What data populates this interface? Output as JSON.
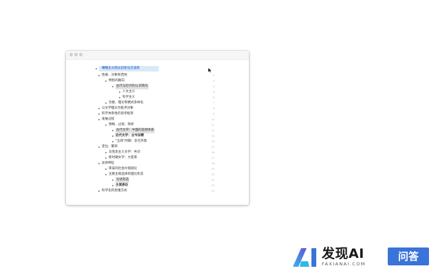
{
  "outline": {
    "root": "唯物主义的认识论与方法论",
    "items": [
      {
        "label": "性质、对象和范围",
        "num": "2"
      },
      {
        "label": "特别的路向",
        "num": "3"
      },
      {
        "label": "古代与近代的认识转向",
        "num": "4"
      },
      {
        "label": "人文主义",
        "num": "5"
      },
      {
        "label": "科学主义",
        "num": "6"
      },
      {
        "label": "功能、理论和模式多样化",
        "num": "7"
      },
      {
        "label": "以文学理论为批评对象",
        "num": "8"
      },
      {
        "label": "科学体系性的思考框架",
        "num": "9"
      },
      {
        "label": "发展过程",
        "num": "10"
      },
      {
        "label": "预制、过渡、转折",
        "num": "11"
      },
      {
        "label": "古代文学：中国的思想体系",
        "num": "12"
      },
      {
        "label": "近代文学：古今杂糅",
        "num": "13"
      },
      {
        "label": "\"五四\"时期：多元开放",
        "num": "14"
      },
      {
        "label": "定位、繁荣",
        "num": "15"
      },
      {
        "label": "马克思主义文学：共识",
        "num": "16"
      },
      {
        "label": "新时期文学：大变革",
        "num": "17"
      },
      {
        "label": "总体特征",
        "num": "18"
      },
      {
        "label": "审美的社会价值观论",
        "num": "19"
      },
      {
        "label": "注重主观选择的理论形态",
        "num": "20"
      },
      {
        "label": "论述形态",
        "num": "21"
      },
      {
        "label": "主观表达",
        "num": "22"
      },
      {
        "label": "科学化的思维方式",
        "num": "23"
      }
    ]
  },
  "brand": {
    "name": "发现AI",
    "domain": "FAXIANAI.COM",
    "tag": "问答",
    "colors": {
      "blue": "#3a73d9",
      "purple": "#6b4fd8",
      "cyan": "#2fb8e8"
    }
  }
}
